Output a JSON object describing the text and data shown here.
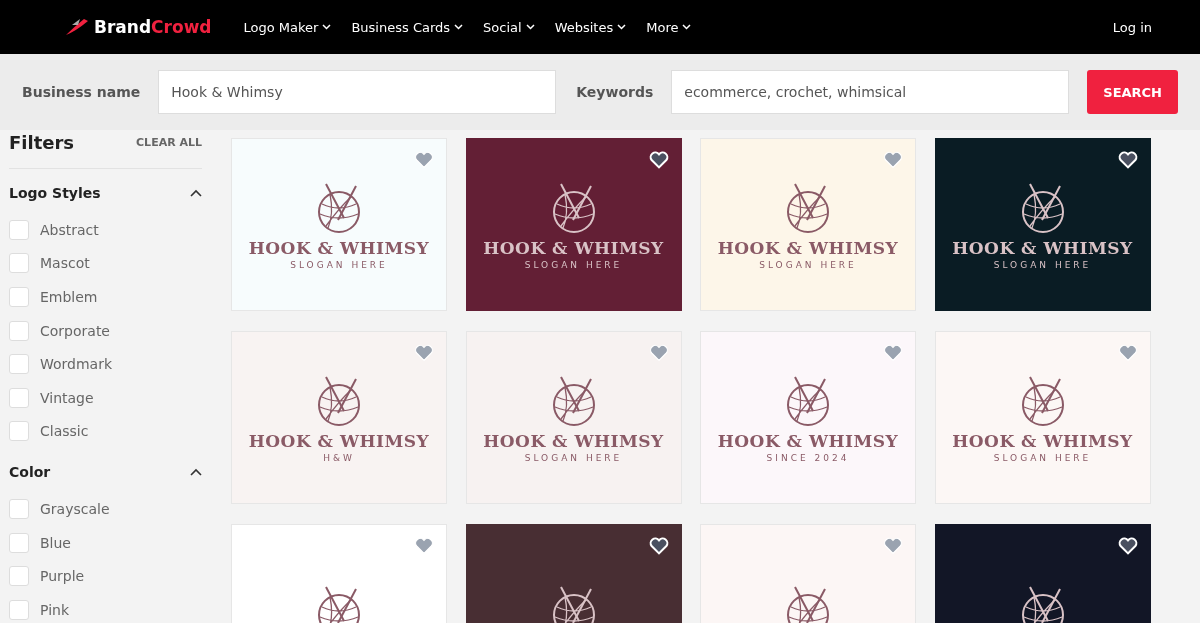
{
  "nav": {
    "brand": {
      "first": "Brand",
      "second": "Crowd"
    },
    "menu": [
      "Logo Maker",
      "Business Cards",
      "Social",
      "Websites",
      "More"
    ],
    "login": "Log in"
  },
  "search": {
    "business_label": "Business name",
    "business_value": "Hook & Whimsy",
    "keywords_label": "Keywords",
    "keywords_value": "ecommerce, crochet, whimsical",
    "button": "SEARCH"
  },
  "sidebar": {
    "title": "Filters",
    "clear": "CLEAR ALL",
    "sections": [
      {
        "title": "Logo Styles",
        "expanded": true,
        "items": [
          {
            "label": "Abstract",
            "checked": false
          },
          {
            "label": "Mascot",
            "checked": false
          },
          {
            "label": "Emblem",
            "checked": false
          },
          {
            "label": "Corporate",
            "checked": false
          },
          {
            "label": "Wordmark",
            "checked": false
          },
          {
            "label": "Vintage",
            "checked": false
          },
          {
            "label": "Classic",
            "checked": false
          }
        ]
      },
      {
        "title": "Color",
        "expanded": true,
        "items": [
          {
            "label": "Grayscale",
            "checked": false
          },
          {
            "label": "Blue",
            "checked": false
          },
          {
            "label": "Purple",
            "checked": false
          },
          {
            "label": "Pink",
            "checked": false
          }
        ]
      }
    ]
  },
  "logos": [
    {
      "kind": "light",
      "color": "#f7fcfd",
      "name": "HOOK & WHIMSY",
      "tagline": "SLOGAN HERE"
    },
    {
      "kind": "dark",
      "color": "#631f35",
      "name": "HOOK & WHIMSY",
      "tagline": "SLOGAN HERE"
    },
    {
      "kind": "light",
      "color": "#fdf6e9",
      "name": "HOOK & WHIMSY",
      "tagline": "SLOGAN HERE"
    },
    {
      "kind": "dark",
      "color": "#0a1c24",
      "name": "HOOK & WHIMSY",
      "tagline": "SLOGAN HERE"
    },
    {
      "kind": "light",
      "color": "#f8f3f2",
      "name": "HOOK & WHIMSY",
      "tagline": "H&W"
    },
    {
      "kind": "light",
      "color": "#f7f2f1",
      "name": "HOOK & WHIMSY",
      "tagline": "SLOGAN HERE"
    },
    {
      "kind": "light",
      "color": "#fcf7fa",
      "name": "HOOK & WHIMSY",
      "tagline": "SINCE 2024"
    },
    {
      "kind": "light",
      "color": "#fcf7f5",
      "name": "HOOK & WHIMSY",
      "tagline": "SLOGAN HERE"
    },
    {
      "kind": "light",
      "color": "#ffffff"
    },
    {
      "kind": "dark",
      "color": "#482e33"
    },
    {
      "kind": "light",
      "color": "#fcf6f5"
    },
    {
      "kind": "dark",
      "color": "#121626"
    }
  ]
}
